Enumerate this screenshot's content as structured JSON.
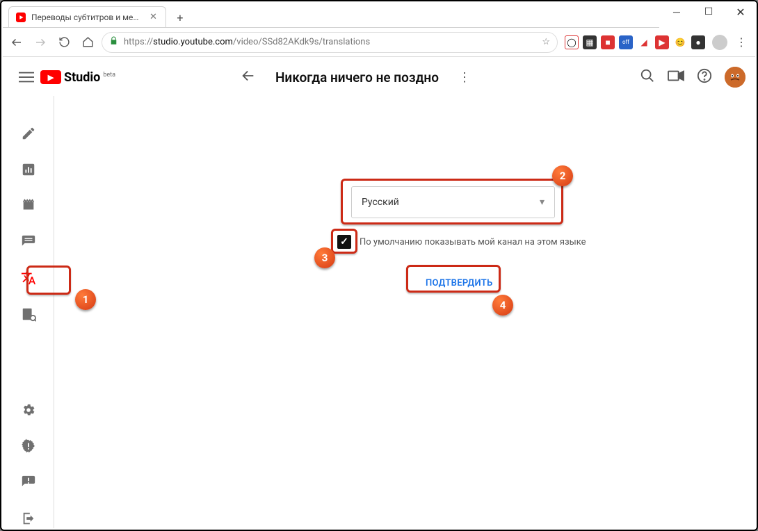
{
  "browser": {
    "tab_title": "Переводы субтитров и метадан...",
    "url_prefix": "https://",
    "url_host": "studio.youtube.com",
    "url_path": "/video/SSd82AKdk9s/translations"
  },
  "header": {
    "logo_text": "Studio",
    "logo_beta": "beta",
    "video_title": "Никогда ничего не поздно"
  },
  "form": {
    "language_selected": "Русский",
    "checkbox_label": "По умолчанию показывать мой канал на этом языке",
    "confirm_label": "ПОДТВЕРДИТЬ"
  },
  "annotations": {
    "b1": "1",
    "b2": "2",
    "b3": "3",
    "b4": "4"
  }
}
